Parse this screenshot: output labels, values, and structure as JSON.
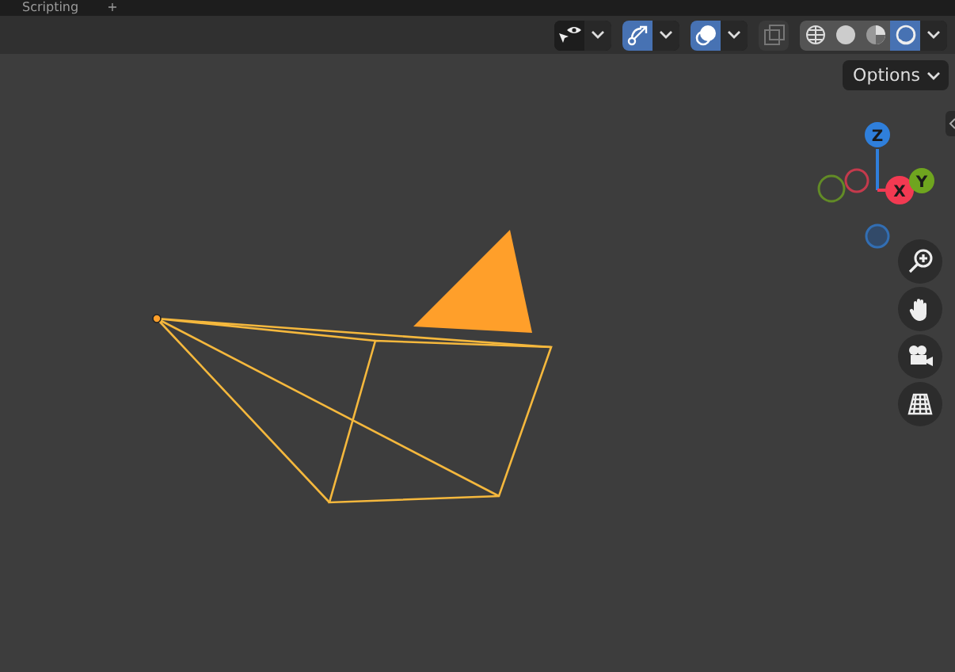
{
  "top_bar": {
    "tab": "Scripting",
    "add_button": "+"
  },
  "header": {
    "visibility": {
      "on": false
    },
    "gizmos": {
      "on": true
    },
    "overlays": {
      "on": true
    },
    "xray": {
      "on": false
    },
    "shading_modes": [
      {
        "kind": "wireframe",
        "selected": false
      },
      {
        "kind": "solid",
        "selected": false
      },
      {
        "kind": "material",
        "selected": false
      },
      {
        "kind": "rendered",
        "selected": true
      }
    ]
  },
  "options_button": "Options",
  "gizmo": {
    "axes": [
      {
        "label": "Z",
        "color": "#2f7fdb"
      },
      {
        "label": "X",
        "color": "#f23a52"
      },
      {
        "label": "Y",
        "color": "#6fa51f"
      }
    ]
  },
  "camera": {
    "selected": true
  }
}
